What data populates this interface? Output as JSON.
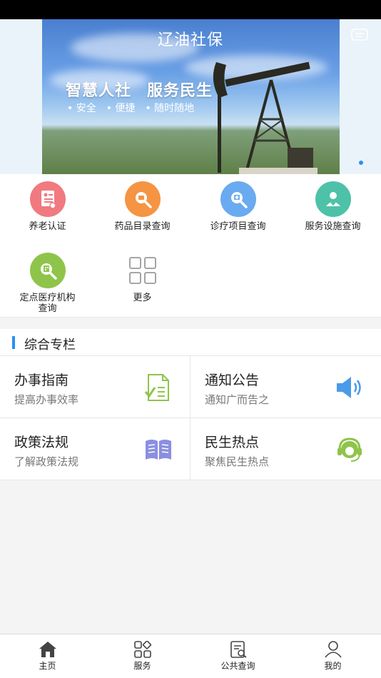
{
  "header": {
    "title": "辽油社保",
    "slogan_1": "智慧人社",
    "slogan_2": "服务民生",
    "features": [
      "• 安全",
      "• 便捷",
      "• 随时随地"
    ]
  },
  "services": [
    {
      "label": "养老认证",
      "color": "#f07a80",
      "icon": "certificate-icon"
    },
    {
      "label": "药品目录查询",
      "color": "#f59442",
      "icon": "drug-search-icon"
    },
    {
      "label": "诊疗项目查询",
      "color": "#6aaaf0",
      "icon": "medical-search-icon"
    },
    {
      "label": "服务设施查询",
      "color": "#4dc2a8",
      "icon": "caregiver-icon"
    },
    {
      "label": "定点医疗机构查询",
      "color": "#8fc44a",
      "icon": "hospital-search-icon"
    },
    {
      "label": "更多",
      "color": "#9a9a9a",
      "icon": "more-grid-icon"
    }
  ],
  "section": {
    "title": "综合专栏",
    "cards": [
      {
        "title": "办事指南",
        "subtitle": "提高办事效率",
        "icon": "checklist-icon"
      },
      {
        "title": "通知公告",
        "subtitle": "通知广而告之",
        "icon": "speaker-icon"
      },
      {
        "title": "政策法规",
        "subtitle": "了解政策法规",
        "icon": "book-icon"
      },
      {
        "title": "民生热点",
        "subtitle": "聚焦民生热点",
        "icon": "headset-icon"
      }
    ]
  },
  "tabbar": {
    "items": [
      {
        "label": "主页",
        "icon": "home-icon"
      },
      {
        "label": "服务",
        "icon": "services-icon"
      },
      {
        "label": "公共查询",
        "icon": "public-search-icon"
      },
      {
        "label": "我的",
        "icon": "profile-icon"
      }
    ]
  },
  "colors": {
    "accent": "#2a8ff7"
  }
}
